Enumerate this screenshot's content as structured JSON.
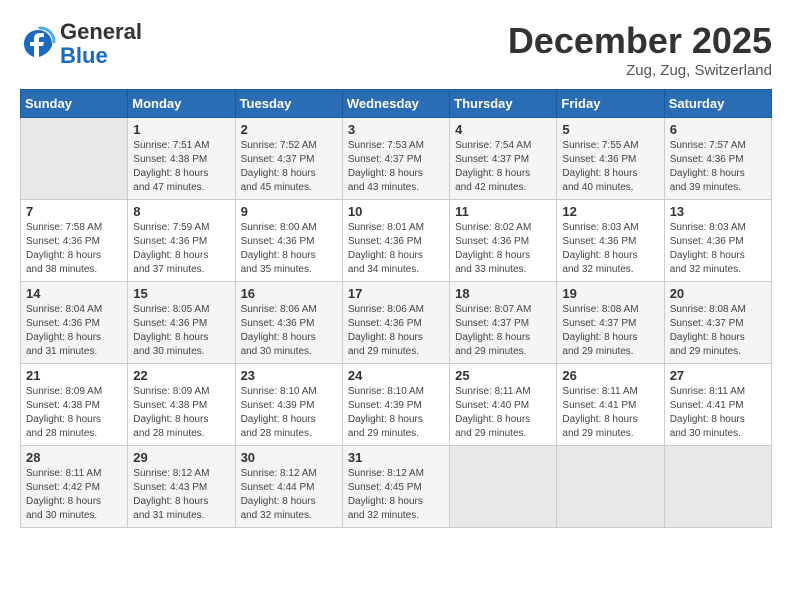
{
  "header": {
    "logo_general": "General",
    "logo_blue": "Blue",
    "month": "December 2025",
    "location": "Zug, Zug, Switzerland"
  },
  "days_of_week": [
    "Sunday",
    "Monday",
    "Tuesday",
    "Wednesday",
    "Thursday",
    "Friday",
    "Saturday"
  ],
  "weeks": [
    [
      {
        "num": "",
        "info": ""
      },
      {
        "num": "1",
        "info": "Sunrise: 7:51 AM\nSunset: 4:38 PM\nDaylight: 8 hours\nand 47 minutes."
      },
      {
        "num": "2",
        "info": "Sunrise: 7:52 AM\nSunset: 4:37 PM\nDaylight: 8 hours\nand 45 minutes."
      },
      {
        "num": "3",
        "info": "Sunrise: 7:53 AM\nSunset: 4:37 PM\nDaylight: 8 hours\nand 43 minutes."
      },
      {
        "num": "4",
        "info": "Sunrise: 7:54 AM\nSunset: 4:37 PM\nDaylight: 8 hours\nand 42 minutes."
      },
      {
        "num": "5",
        "info": "Sunrise: 7:55 AM\nSunset: 4:36 PM\nDaylight: 8 hours\nand 40 minutes."
      },
      {
        "num": "6",
        "info": "Sunrise: 7:57 AM\nSunset: 4:36 PM\nDaylight: 8 hours\nand 39 minutes."
      }
    ],
    [
      {
        "num": "7",
        "info": "Sunrise: 7:58 AM\nSunset: 4:36 PM\nDaylight: 8 hours\nand 38 minutes."
      },
      {
        "num": "8",
        "info": "Sunrise: 7:59 AM\nSunset: 4:36 PM\nDaylight: 8 hours\nand 37 minutes."
      },
      {
        "num": "9",
        "info": "Sunrise: 8:00 AM\nSunset: 4:36 PM\nDaylight: 8 hours\nand 35 minutes."
      },
      {
        "num": "10",
        "info": "Sunrise: 8:01 AM\nSunset: 4:36 PM\nDaylight: 8 hours\nand 34 minutes."
      },
      {
        "num": "11",
        "info": "Sunrise: 8:02 AM\nSunset: 4:36 PM\nDaylight: 8 hours\nand 33 minutes."
      },
      {
        "num": "12",
        "info": "Sunrise: 8:03 AM\nSunset: 4:36 PM\nDaylight: 8 hours\nand 32 minutes."
      },
      {
        "num": "13",
        "info": "Sunrise: 8:03 AM\nSunset: 4:36 PM\nDaylight: 8 hours\nand 32 minutes."
      }
    ],
    [
      {
        "num": "14",
        "info": "Sunrise: 8:04 AM\nSunset: 4:36 PM\nDaylight: 8 hours\nand 31 minutes."
      },
      {
        "num": "15",
        "info": "Sunrise: 8:05 AM\nSunset: 4:36 PM\nDaylight: 8 hours\nand 30 minutes."
      },
      {
        "num": "16",
        "info": "Sunrise: 8:06 AM\nSunset: 4:36 PM\nDaylight: 8 hours\nand 30 minutes."
      },
      {
        "num": "17",
        "info": "Sunrise: 8:06 AM\nSunset: 4:36 PM\nDaylight: 8 hours\nand 29 minutes."
      },
      {
        "num": "18",
        "info": "Sunrise: 8:07 AM\nSunset: 4:37 PM\nDaylight: 8 hours\nand 29 minutes."
      },
      {
        "num": "19",
        "info": "Sunrise: 8:08 AM\nSunset: 4:37 PM\nDaylight: 8 hours\nand 29 minutes."
      },
      {
        "num": "20",
        "info": "Sunrise: 8:08 AM\nSunset: 4:37 PM\nDaylight: 8 hours\nand 29 minutes."
      }
    ],
    [
      {
        "num": "21",
        "info": "Sunrise: 8:09 AM\nSunset: 4:38 PM\nDaylight: 8 hours\nand 28 minutes."
      },
      {
        "num": "22",
        "info": "Sunrise: 8:09 AM\nSunset: 4:38 PM\nDaylight: 8 hours\nand 28 minutes."
      },
      {
        "num": "23",
        "info": "Sunrise: 8:10 AM\nSunset: 4:39 PM\nDaylight: 8 hours\nand 28 minutes."
      },
      {
        "num": "24",
        "info": "Sunrise: 8:10 AM\nSunset: 4:39 PM\nDaylight: 8 hours\nand 29 minutes."
      },
      {
        "num": "25",
        "info": "Sunrise: 8:11 AM\nSunset: 4:40 PM\nDaylight: 8 hours\nand 29 minutes."
      },
      {
        "num": "26",
        "info": "Sunrise: 8:11 AM\nSunset: 4:41 PM\nDaylight: 8 hours\nand 29 minutes."
      },
      {
        "num": "27",
        "info": "Sunrise: 8:11 AM\nSunset: 4:41 PM\nDaylight: 8 hours\nand 30 minutes."
      }
    ],
    [
      {
        "num": "28",
        "info": "Sunrise: 8:11 AM\nSunset: 4:42 PM\nDaylight: 8 hours\nand 30 minutes."
      },
      {
        "num": "29",
        "info": "Sunrise: 8:12 AM\nSunset: 4:43 PM\nDaylight: 8 hours\nand 31 minutes."
      },
      {
        "num": "30",
        "info": "Sunrise: 8:12 AM\nSunset: 4:44 PM\nDaylight: 8 hours\nand 32 minutes."
      },
      {
        "num": "31",
        "info": "Sunrise: 8:12 AM\nSunset: 4:45 PM\nDaylight: 8 hours\nand 32 minutes."
      },
      {
        "num": "",
        "info": ""
      },
      {
        "num": "",
        "info": ""
      },
      {
        "num": "",
        "info": ""
      }
    ]
  ]
}
